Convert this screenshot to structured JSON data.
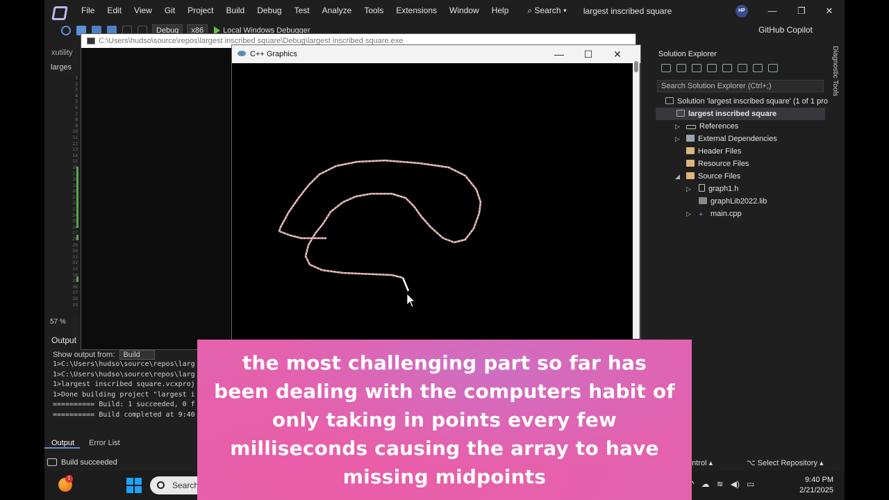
{
  "menubar": {
    "items": [
      "File",
      "Edit",
      "View",
      "Git",
      "Project",
      "Build",
      "Debug",
      "Test",
      "Analyze",
      "Tools",
      "Extensions",
      "Window",
      "Help"
    ],
    "search_label": "Search",
    "solution_title": "largest inscribed square",
    "account_initials": "HP"
  },
  "toolbar": {
    "config": "Debug",
    "platform": "x86",
    "debugger": "Local Windows Debugger",
    "copilot_label": "GitHub Copilot"
  },
  "editor": {
    "doc_tab": "xutility",
    "file_tab": "larges",
    "zoom": "57 %",
    "line_numbers": [
      "1",
      "2",
      "3",
      "4",
      "5",
      "6",
      "7",
      "8",
      "9",
      "10",
      "11",
      "12",
      "13",
      "14",
      "15",
      "16",
      "17",
      "18",
      "19",
      "20",
      "21",
      "22",
      "23",
      "24",
      "25",
      "26",
      "27",
      "28",
      "29",
      "30",
      "31",
      "32",
      "33",
      "34",
      "35",
      "36",
      "37",
      "38",
      "39"
    ]
  },
  "console": {
    "title": "C:\\Users\\hudso\\source\\repos\\largest inscribed square\\Debug\\largest inscribed square.exe"
  },
  "graphics_window": {
    "title": "C++ Graphics"
  },
  "output": {
    "header": "Output",
    "show_from_label": "Show output from:",
    "show_from_value": "Build",
    "lines": [
      "1>C:\\Users\\hudso\\source\\repos\\larg",
      "1>C:\\Users\\hudso\\source\\repos\\larg",
      "1>largest inscribed square.vcxproj",
      "1>Done building project \"largest i",
      "========== Build: 1 succeeded, 0 f",
      "========== Build completed at 9:40"
    ],
    "tabs": [
      "Output",
      "Error List"
    ]
  },
  "statusbar": {
    "message": "Build succeeded",
    "source_control": "ontrol",
    "select_repo": "Select Repository"
  },
  "solution_explorer": {
    "title": "Solution Explorer",
    "search_placeholder": "Search Solution Explorer (Ctrl+;)",
    "items": [
      {
        "label": "Solution 'largest inscribed square' (1 of 1 pro",
        "icon": "solution-icon"
      },
      {
        "label": "largest inscribed square",
        "icon": "project-icon"
      },
      {
        "label": "References",
        "icon": "references-icon"
      },
      {
        "label": "External Dependencies",
        "icon": "dependencies-icon"
      },
      {
        "label": "Header Files",
        "icon": "folder-icon"
      },
      {
        "label": "Resource Files",
        "icon": "folder-icon"
      },
      {
        "label": "Source Files",
        "icon": "folder-icon"
      },
      {
        "label": "graph1.h",
        "icon": "header-file-icon"
      },
      {
        "label": "graphLib2022.lib",
        "icon": "lib-file-icon"
      },
      {
        "label": "main.cpp",
        "icon": "cpp-file-icon"
      }
    ],
    "diagnostic_tools": "Diagnostic Tools"
  },
  "taskbar": {
    "search_label": "Search",
    "notification_count": "1",
    "time": "9:40 PM",
    "date": "2/21/2025"
  },
  "caption": {
    "text": "the most challenging part so far has been dealing with the computers habit of only taking in points every few milliseconds causing the array to have missing midpoints"
  },
  "colors": {
    "caption_bg": "#e461ad",
    "ide_bg": "#1f1f1f",
    "accent": "#6b8cd3",
    "stroke": "#f3c9c9"
  }
}
